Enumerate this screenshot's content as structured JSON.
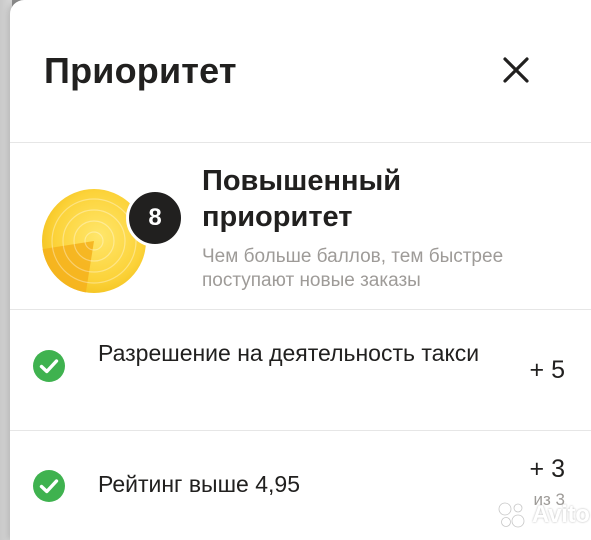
{
  "header": {
    "title": "Приоритет",
    "close_icon": "close-icon"
  },
  "priority": {
    "score": "8",
    "level_title": "Повышенный приоритет",
    "description": "Чем больше баллов, тем быстрее поступают новые заказы",
    "badge_icon": "priority-radar-icon",
    "badge_fill_fraction": 0.8
  },
  "criteria": [
    {
      "label": "Разрешение на деятельность такси",
      "points": "+ 5",
      "icon": "check-circle-icon"
    },
    {
      "label": "Рейтинг выше 4,95",
      "points": "+ 3",
      "max": "из 3",
      "icon": "check-circle-icon"
    }
  ],
  "watermark": {
    "text": "Avito",
    "icon": "avito-dots-icon"
  },
  "colors": {
    "accent_yellow": "#fcd33a",
    "check_green": "#3fb24f",
    "text_primary": "#21201f",
    "text_secondary": "#9e9b98"
  }
}
